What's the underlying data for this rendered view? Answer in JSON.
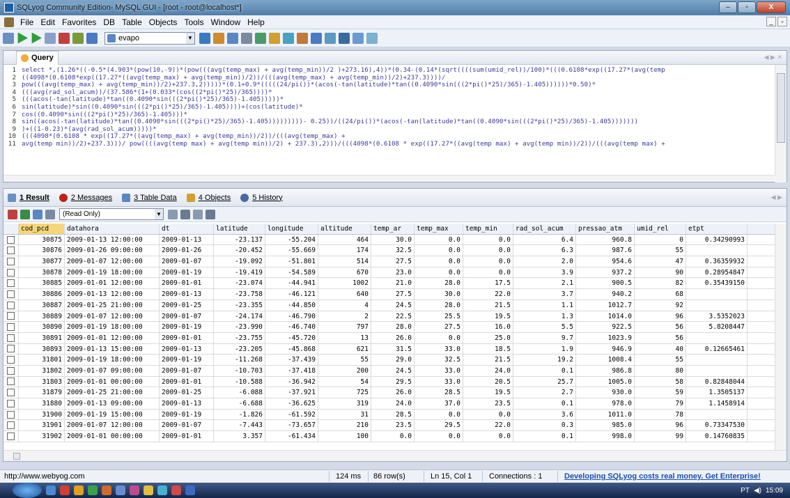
{
  "window": {
    "title": "SQLyog Community Edition- MySQL GUI - [root - root@localhost*]",
    "buttons": [
      "–",
      "▫",
      "X"
    ]
  },
  "menu": [
    "File",
    "Edit",
    "Favorites",
    "DB",
    "Table",
    "Objects",
    "Tools",
    "Window",
    "Help"
  ],
  "toolbar": {
    "database": "evapo"
  },
  "query": {
    "tab_label": "Query",
    "lines": [
      {
        "n": "1",
        "t": "select *,(1.26*((-0.5*(4.903*(pow(10,-9))*(pow(((avg(temp_max) + avg(temp_min))/2 )+273.16),4))*(0.34-(0.14*(sqrt((((sum(umid_rel))/100)*(((0.6108*exp((17.27*(avg(temp"
      },
      {
        "n": "2",
        "t": "((4098*(0.6108*exp((17.27*((avg(temp_max) + avg(temp_min))/2))/(((avg(temp_max) + avg(temp_min))/2)+237.3))))/"
      },
      {
        "n": "3",
        "t": "pow(((avg(temp_max) + avg(temp_min))/2)+237.3,2)))))*(0.1+0.9*(((((24/pi())*(acos(-tan(latitude)*tan((0.4090*sin(((2*pi()*25)/365)-1.405))))))*0.50)*"
      },
      {
        "n": "4",
        "t": "(((avg(rad_sol_acum))/(37.586*(1+(0.033*(cos((2*pi()*25)/365))))*"
      },
      {
        "n": "5",
        "t": "(((acos(-tan(latitude)*tan((0.4090*sin(((2*pi()*25)/365)-1.405)))))*"
      },
      {
        "n": "6",
        "t": "sin(latitude)*sin((0.4090*sin(((2*pi()*25)/365)-1.405))))+(cos(latitude)*"
      },
      {
        "n": "7",
        "t": "cos((0.4090*sin(((2*pi()*25)/365)-1.405)))*"
      },
      {
        "n": "8",
        "t": "sin((acos(-tan(latitude)*tan((0.4090*sin(((2*pi()*25)/365)-1.405)))))))))- 0.25))/((24/pi())*(acos(-tan(latitude)*tan((0.4090*sin(((2*pi()*25)/365)-1.405)))))))"
      },
      {
        "n": "9",
        "t": ")+((1-0.23)*(avg(rad_sol_acum)))))*"
      },
      {
        "n": "10",
        "t": "(((4098*(0.6108 * exp((17.27*((avg(temp_max) + avg(temp_min))/2))/(((avg(temp_max) +"
      },
      {
        "n": "11",
        "t": "avg(temp min))/2)+237.3)))/ pow((((avg(temp max) + avg(temp min))/2) + 237.3),2)))/(((4098*(0.6108 * exp((17.27*((avg(temp max) + avg(temp min))/2))/(((avg(temp max) +"
      }
    ]
  },
  "results": {
    "tabs": [
      {
        "num": "1",
        "label": "Result"
      },
      {
        "num": "2",
        "label": "Messages"
      },
      {
        "num": "3",
        "label": "Table Data"
      },
      {
        "num": "4",
        "label": "Objects"
      },
      {
        "num": "5",
        "label": "History"
      }
    ],
    "mode": "(Read Only)",
    "columns": [
      "cod_pcd",
      "datahora",
      "dt",
      "latitude",
      "longitude",
      "altitude",
      "temp_ar",
      "temp_max",
      "temp_min",
      "rad_sol_acum",
      "pressao_atm",
      "umid_rel",
      "etpt"
    ],
    "rows": [
      [
        "30875",
        "2009-01-13 12:00:00",
        "2009-01-13",
        "-23.137",
        "-55.204",
        "464",
        "30.0",
        "0.0",
        "0.0",
        "6.4",
        "960.8",
        "0",
        "0.34290993"
      ],
      [
        "30876",
        "2009-01-26 09:00:00",
        "2009-01-26",
        "-20.452",
        "-55.669",
        "174",
        "32.5",
        "0.0",
        "0.0",
        "6.3",
        "987.6",
        "55",
        ""
      ],
      [
        "30877",
        "2009-01-07 12:00:00",
        "2009-01-07",
        "-19.092",
        "-51.801",
        "514",
        "27.5",
        "0.0",
        "0.0",
        "2.0",
        "954.6",
        "47",
        "0.36359932"
      ],
      [
        "30878",
        "2009-01-19 18:00:00",
        "2009-01-19",
        "-19.419",
        "-54.589",
        "670",
        "23.0",
        "0.0",
        "0.0",
        "3.9",
        "937.2",
        "90",
        "0.28954847"
      ],
      [
        "30885",
        "2009-01-01 12:00:00",
        "2009-01-01",
        "-23.074",
        "-44.941",
        "1002",
        "21.0",
        "28.0",
        "17.5",
        "2.1",
        "900.5",
        "82",
        "0.35439150"
      ],
      [
        "30886",
        "2009-01-13 12:00:00",
        "2009-01-13",
        "-23.758",
        "-46.121",
        "640",
        "27.5",
        "30.0",
        "22.0",
        "3.7",
        "940.2",
        "68",
        ""
      ],
      [
        "30887",
        "2009-01-25 21:00:00",
        "2009-01-25",
        "-23.355",
        "-44.850",
        "4",
        "24.5",
        "28.0",
        "21.5",
        "1.1",
        "1012.7",
        "92",
        ""
      ],
      [
        "30889",
        "2009-01-07 12:00:00",
        "2009-01-07",
        "-24.174",
        "-46.790",
        "2",
        "22.5",
        "25.5",
        "19.5",
        "1.3",
        "1014.0",
        "96",
        "3.5352023"
      ],
      [
        "30890",
        "2009-01-19 18:00:00",
        "2009-01-19",
        "-23.990",
        "-46.740",
        "797",
        "28.0",
        "27.5",
        "16.0",
        "5.5",
        "922.5",
        "56",
        "5.8208447"
      ],
      [
        "30891",
        "2009-01-01 12:00:00",
        "2009-01-01",
        "-23.755",
        "-45.720",
        "13",
        "26.0",
        "0.0",
        "25.0",
        "9.7",
        "1023.9",
        "56",
        ""
      ],
      [
        "30893",
        "2009-01-13 15:00:00",
        "2009-01-13",
        "-23.205",
        "-45.868",
        "621",
        "31.5",
        "33.0",
        "18.5",
        "1.9",
        "946.9",
        "40",
        "0.12665461"
      ],
      [
        "31801",
        "2009-01-19 18:00:00",
        "2009-01-19",
        "-11.268",
        "-37.439",
        "55",
        "29.0",
        "32.5",
        "21.5",
        "19.2",
        "1008.4",
        "55",
        ""
      ],
      [
        "31802",
        "2009-01-07 09:00:00",
        "2009-01-07",
        "-10.703",
        "-37.418",
        "200",
        "24.5",
        "33.0",
        "24.0",
        "0.1",
        "986.8",
        "80",
        ""
      ],
      [
        "31803",
        "2009-01-01 00:00:00",
        "2009-01-01",
        "-10.588",
        "-36.942",
        "54",
        "29.5",
        "33.0",
        "20.5",
        "25.7",
        "1005.0",
        "58",
        "0.82848044"
      ],
      [
        "31879",
        "2009-01-25 21:00:00",
        "2009-01-25",
        "-6.088",
        "-37.921",
        "725",
        "26.0",
        "28.5",
        "19.5",
        "2.7",
        "930.0",
        "59",
        "1.3505137"
      ],
      [
        "31880",
        "2009-01-13 09:00:00",
        "2009-01-13",
        "-6.688",
        "-36.625",
        "319",
        "24.0",
        "37.0",
        "23.5",
        "0.1",
        "978.0",
        "79",
        "1.1458914"
      ],
      [
        "31900",
        "2009-01-19 15:00:00",
        "2009-01-19",
        "-1.826",
        "-61.592",
        "31",
        "28.5",
        "0.0",
        "0.0",
        "3.6",
        "1011.0",
        "78",
        ""
      ],
      [
        "31901",
        "2009-01-07 12:00:00",
        "2009-01-07",
        "-7.443",
        "-73.657",
        "210",
        "23.5",
        "29.5",
        "22.0",
        "0.3",
        "985.0",
        "96",
        "0.73347530"
      ],
      [
        "31902",
        "2009-01-01 00:00:00",
        "2009-01-01",
        "3.357",
        "-61.434",
        "100",
        "0.0",
        "0.0",
        "0.0",
        "0.1",
        "998.0",
        "99",
        "0.14760835"
      ]
    ]
  },
  "status": {
    "url": "http://www.webyog.com",
    "time": "124 ms",
    "rows": "86 row(s)",
    "pos": "Ln 15, Col 1",
    "connections": "Connections : 1",
    "promo": "Developing SQLyog costs real money. Get Enterprise!"
  },
  "taskbar": {
    "lang": "PT",
    "clock": "15:09"
  }
}
